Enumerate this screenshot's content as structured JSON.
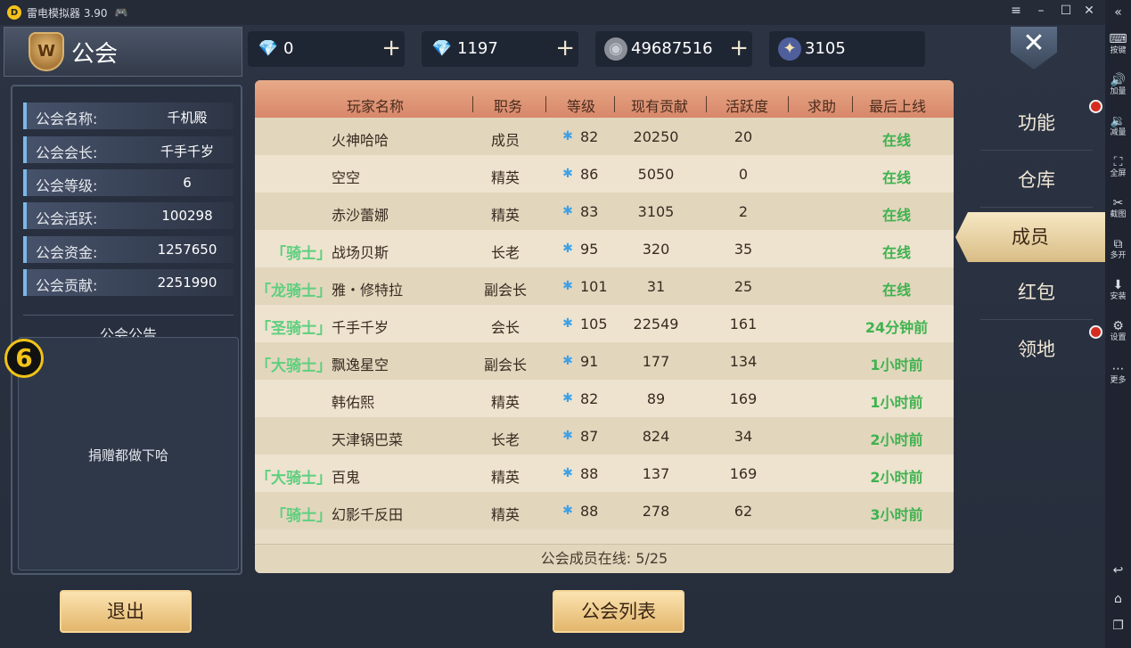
{
  "emulator": {
    "title": "雷电模拟器 3.90",
    "sidebar": [
      {
        "icon": "keyboard-icon",
        "glyph": "⌨",
        "label": "按键"
      },
      {
        "icon": "volume-up-icon",
        "glyph": "🔊",
        "label": "加量"
      },
      {
        "icon": "volume-down-icon",
        "glyph": "🔉",
        "label": "减量"
      },
      {
        "icon": "fullscreen-icon",
        "glyph": "⛶",
        "label": "全屏"
      },
      {
        "icon": "scissors-icon",
        "glyph": "✂",
        "label": "截图"
      },
      {
        "icon": "multi-open-icon",
        "glyph": "⧉",
        "label": "多开"
      },
      {
        "icon": "apk-install-icon",
        "glyph": "⬇",
        "label": "安装"
      },
      {
        "icon": "gear-icon",
        "glyph": "⚙",
        "label": "设置"
      },
      {
        "icon": "more-icon",
        "glyph": "⋯",
        "label": "更多"
      }
    ]
  },
  "header": {
    "title": "公会",
    "resources": [
      {
        "icon": "diamond-icon",
        "glyph": "💎",
        "value": "0"
      },
      {
        "icon": "bound-diamond-icon",
        "glyph": "💎",
        "value": "1197"
      },
      {
        "icon": "silver-coin-icon",
        "glyph": "◉",
        "value": "49687516"
      },
      {
        "icon": "rank-badge-icon",
        "glyph": "✦",
        "value": "3105"
      }
    ]
  },
  "guild_info": [
    {
      "key": "公会名称:",
      "value": "千机殿"
    },
    {
      "key": "公会会长:",
      "value": "千手千岁"
    },
    {
      "key": "公会等级:",
      "value": "6"
    },
    {
      "key": "公会活跃:",
      "value": "100298"
    },
    {
      "key": "公会资金:",
      "value": "1257650"
    },
    {
      "key": "公会贡献:",
      "value": "2251990"
    }
  ],
  "notice": {
    "title": "公会公告",
    "text": "捐赠都做下哈"
  },
  "float_ball_label": "6",
  "table": {
    "columns": [
      "玩家名称",
      "职务",
      "等级",
      "现有贡献",
      "活跃度",
      "求助",
      "最后上线"
    ],
    "rows": [
      {
        "title": "",
        "name": "火神哈哈",
        "role": "成员",
        "level": "82",
        "contribution": "20250",
        "activity": "20",
        "help": "",
        "last_online": "在线"
      },
      {
        "title": "",
        "name": "空空",
        "role": "精英",
        "level": "86",
        "contribution": "5050",
        "activity": "0",
        "help": "",
        "last_online": "在线"
      },
      {
        "title": "",
        "name": "赤沙蕾娜",
        "role": "精英",
        "level": "83",
        "contribution": "3105",
        "activity": "2",
        "help": "",
        "last_online": "在线"
      },
      {
        "title": "「骑士」",
        "name": "战场贝斯",
        "role": "长老",
        "level": "95",
        "contribution": "320",
        "activity": "35",
        "help": "",
        "last_online": "在线"
      },
      {
        "title": "「龙骑士」",
        "name": "雅・修特拉",
        "role": "副会长",
        "level": "101",
        "contribution": "31",
        "activity": "25",
        "help": "",
        "last_online": "在线"
      },
      {
        "title": "「圣骑士」",
        "name": "千手千岁",
        "role": "会长",
        "level": "105",
        "contribution": "22549",
        "activity": "161",
        "help": "",
        "last_online": "24分钟前"
      },
      {
        "title": "「大骑士」",
        "name": "飘逸星空",
        "role": "副会长",
        "level": "91",
        "contribution": "177",
        "activity": "134",
        "help": "",
        "last_online": "1小时前"
      },
      {
        "title": "",
        "name": "韩佑熙",
        "role": "精英",
        "level": "82",
        "contribution": "89",
        "activity": "169",
        "help": "",
        "last_online": "1小时前"
      },
      {
        "title": "",
        "name": "天津锅巴菜",
        "role": "长老",
        "level": "87",
        "contribution": "824",
        "activity": "34",
        "help": "",
        "last_online": "2小时前"
      },
      {
        "title": "「大骑士」",
        "name": "百鬼",
        "role": "精英",
        "level": "88",
        "contribution": "137",
        "activity": "169",
        "help": "",
        "last_online": "2小时前"
      },
      {
        "title": "「骑士」",
        "name": "幻影千反田",
        "role": "精英",
        "level": "88",
        "contribution": "278",
        "activity": "62",
        "help": "",
        "last_online": "3小时前"
      }
    ],
    "footer": "公会成员在线: 5/25"
  },
  "tabs": [
    {
      "label": "功能",
      "active": false,
      "badge": true
    },
    {
      "label": "仓库",
      "active": false,
      "badge": false
    },
    {
      "label": "成员",
      "active": true,
      "badge": false
    },
    {
      "label": "红包",
      "active": false,
      "badge": false
    },
    {
      "label": "领地",
      "active": false,
      "badge": true
    }
  ],
  "buttons": {
    "exit": "退出",
    "guild_list": "公会列表"
  },
  "colors": {
    "online": "#3fb24f",
    "title_badge": "#5fcf7f",
    "table_head": "#d8876a",
    "tab_active": "#f6e7c3",
    "badge_red": "#d62c1f"
  }
}
